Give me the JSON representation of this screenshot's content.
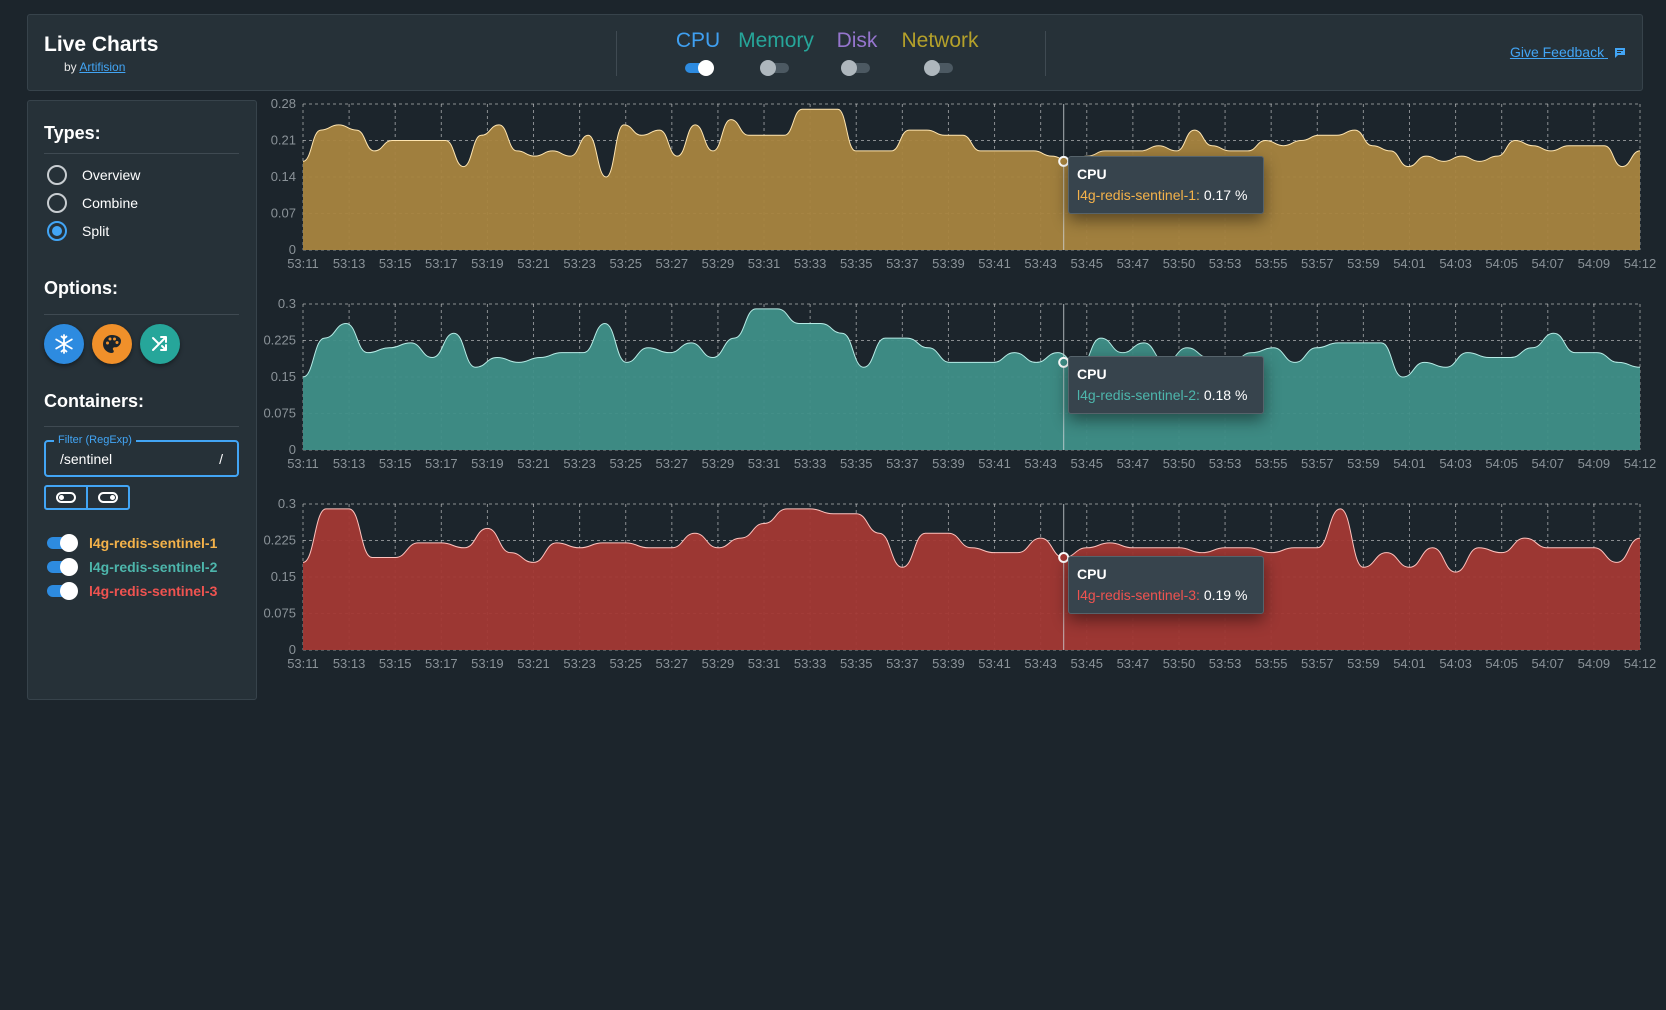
{
  "header": {
    "title": "Live Charts",
    "by_prefix": "by",
    "by_link": "Artifision",
    "feedback_label": "Give Feedback",
    "feedback_icon": "feedback-icon",
    "metric_tabs": [
      {
        "label": "CPU",
        "color": "#3f9ff0",
        "enabled": true
      },
      {
        "label": "Memory",
        "color": "#26a69a",
        "enabled": false
      },
      {
        "label": "Disk",
        "color": "#9575cd",
        "enabled": false
      },
      {
        "label": "Network",
        "color": "#b5a12a",
        "enabled": false
      }
    ]
  },
  "sidebar": {
    "types_title": "Types:",
    "types": [
      {
        "label": "Overview",
        "checked": false
      },
      {
        "label": "Combine",
        "checked": false
      },
      {
        "label": "Split",
        "checked": true
      }
    ],
    "options_title": "Options:",
    "options": [
      {
        "icon": "snowflake-icon",
        "color": "#2d8be0"
      },
      {
        "icon": "palette-icon",
        "color": "#f0902a"
      },
      {
        "icon": "shuffle-icon",
        "color": "#26a69a"
      }
    ],
    "containers_title": "Containers:",
    "filter_label": "Filter (RegExp)",
    "filter_value": "/sentinel",
    "filter_suffix": "/",
    "containers": [
      {
        "label": "l4g-redis-sentinel-1",
        "color": "#f4b24a",
        "enabled": true
      },
      {
        "label": "l4g-redis-sentinel-2",
        "color": "#4db6ac",
        "enabled": true
      },
      {
        "label": "l4g-redis-sentinel-3",
        "color": "#ef5350",
        "enabled": true
      }
    ]
  },
  "tooltips": [
    {
      "title": "CPU",
      "series": "l4g-redis-sentinel-1:",
      "value": "0.17 %"
    },
    {
      "title": "CPU",
      "series": "l4g-redis-sentinel-2:",
      "value": "0.18 %"
    },
    {
      "title": "CPU",
      "series": "l4g-redis-sentinel-3:",
      "value": "0.19 %"
    }
  ],
  "chart_data": [
    {
      "type": "area",
      "series_name": "l4g-redis-sentinel-1",
      "fill": "#a8843f",
      "stroke": "#ffe5b0",
      "x_labels": [
        "53:11",
        "53:13",
        "53:15",
        "53:17",
        "53:19",
        "53:21",
        "53:23",
        "53:25",
        "53:27",
        "53:29",
        "53:31",
        "53:33",
        "53:35",
        "53:37",
        "53:39",
        "53:41",
        "53:43",
        "53:45",
        "53:47",
        "53:50",
        "53:53",
        "53:55",
        "53:57",
        "53:59",
        "54:01",
        "54:03",
        "54:05",
        "54:07",
        "54:09",
        "54:12"
      ],
      "y_ticks": [
        "0.28",
        "0.21",
        "0.14",
        "0.07",
        "0"
      ],
      "ylim": [
        0,
        0.28
      ],
      "values": [
        0.17,
        0.23,
        0.24,
        0.23,
        0.19,
        0.21,
        0.21,
        0.21,
        0.21,
        0.16,
        0.22,
        0.24,
        0.19,
        0.18,
        0.19,
        0.18,
        0.22,
        0.14,
        0.24,
        0.22,
        0.23,
        0.18,
        0.24,
        0.19,
        0.25,
        0.22,
        0.22,
        0.22,
        0.27,
        0.27,
        0.27,
        0.19,
        0.19,
        0.19,
        0.23,
        0.23,
        0.22,
        0.22,
        0.19,
        0.19,
        0.19,
        0.19,
        0.18,
        0.17,
        0.18,
        0.19,
        0.19,
        0.19,
        0.2,
        0.19,
        0.23,
        0.2,
        0.19,
        0.19,
        0.21,
        0.2,
        0.21,
        0.22,
        0.22,
        0.23,
        0.2,
        0.19,
        0.16,
        0.18,
        0.17,
        0.18,
        0.17,
        0.18,
        0.21,
        0.2,
        0.19,
        0.2,
        0.2,
        0.2,
        0.16,
        0.19
      ],
      "hover_value": 0.17,
      "hover_label": "53:44"
    },
    {
      "type": "area",
      "series_name": "l4g-redis-sentinel-2",
      "fill": "#3f8f88",
      "stroke": "#b6ece6",
      "x_labels": [
        "53:11",
        "53:13",
        "53:15",
        "53:17",
        "53:19",
        "53:21",
        "53:23",
        "53:25",
        "53:27",
        "53:29",
        "53:31",
        "53:33",
        "53:35",
        "53:37",
        "53:39",
        "53:41",
        "53:43",
        "53:45",
        "53:47",
        "53:50",
        "53:53",
        "53:55",
        "53:57",
        "53:59",
        "54:01",
        "54:03",
        "54:05",
        "54:07",
        "54:09",
        "54:12"
      ],
      "y_ticks": [
        "0.3",
        "0.225",
        "0.15",
        "0.075",
        "0"
      ],
      "ylim": [
        0,
        0.3
      ],
      "values": [
        0.15,
        0.23,
        0.26,
        0.2,
        0.21,
        0.22,
        0.19,
        0.24,
        0.17,
        0.19,
        0.18,
        0.19,
        0.2,
        0.2,
        0.26,
        0.18,
        0.21,
        0.2,
        0.22,
        0.19,
        0.23,
        0.29,
        0.29,
        0.26,
        0.26,
        0.24,
        0.17,
        0.23,
        0.23,
        0.21,
        0.18,
        0.18,
        0.18,
        0.2,
        0.18,
        0.2,
        0.17,
        0.23,
        0.2,
        0.22,
        0.18,
        0.21,
        0.19,
        0.18,
        0.2,
        0.21,
        0.18,
        0.21,
        0.22,
        0.22,
        0.22,
        0.15,
        0.18,
        0.17,
        0.2,
        0.19,
        0.19,
        0.21,
        0.24,
        0.2,
        0.2,
        0.18,
        0.17
      ],
      "hover_value": 0.18,
      "hover_label": "53:44"
    },
    {
      "type": "area",
      "series_name": "l4g-redis-sentinel-3",
      "fill": "#a33834",
      "stroke": "#ffc2bd",
      "x_labels": [
        "53:11",
        "53:13",
        "53:15",
        "53:17",
        "53:19",
        "53:21",
        "53:23",
        "53:25",
        "53:27",
        "53:29",
        "53:31",
        "53:33",
        "53:35",
        "53:37",
        "53:39",
        "53:41",
        "53:43",
        "53:45",
        "53:47",
        "53:50",
        "53:53",
        "53:55",
        "53:57",
        "53:59",
        "54:01",
        "54:03",
        "54:05",
        "54:07",
        "54:09",
        "54:12"
      ],
      "y_ticks": [
        "0.3",
        "0.225",
        "0.15",
        "0.075",
        "0"
      ],
      "ylim": [
        0,
        0.3
      ],
      "values": [
        0.18,
        0.29,
        0.29,
        0.19,
        0.19,
        0.22,
        0.22,
        0.21,
        0.25,
        0.2,
        0.18,
        0.22,
        0.21,
        0.22,
        0.22,
        0.21,
        0.21,
        0.24,
        0.21,
        0.23,
        0.26,
        0.29,
        0.29,
        0.28,
        0.28,
        0.24,
        0.17,
        0.24,
        0.24,
        0.21,
        0.2,
        0.2,
        0.23,
        0.19,
        0.21,
        0.22,
        0.21,
        0.21,
        0.21,
        0.2,
        0.21,
        0.21,
        0.2,
        0.21,
        0.21,
        0.29,
        0.17,
        0.2,
        0.17,
        0.21,
        0.16,
        0.21,
        0.2,
        0.23,
        0.21,
        0.21,
        0.21,
        0.18,
        0.23
      ],
      "hover_value": 0.19,
      "hover_label": "53:44"
    }
  ]
}
